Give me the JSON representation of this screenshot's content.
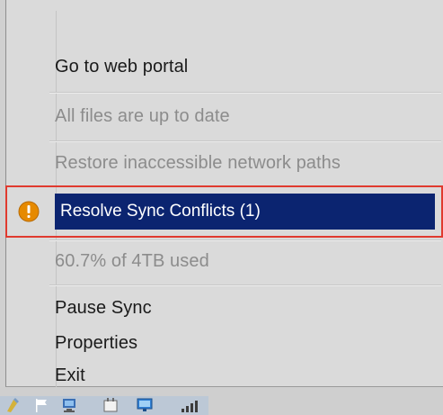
{
  "menu": {
    "items": [
      {
        "label": "Go to web portal",
        "enabled": true
      },
      {
        "label": "All files are up to date",
        "enabled": false
      },
      {
        "label": "Restore inaccessible network paths",
        "enabled": false
      },
      {
        "label": "Resolve Sync Conflicts (1)",
        "enabled": true,
        "highlighted": true,
        "icon": "warning-icon"
      },
      {
        "label": "60.7% of 4TB used",
        "enabled": false
      },
      {
        "label": "Pause Sync",
        "enabled": true
      },
      {
        "label": "Properties",
        "enabled": true
      },
      {
        "label": "Exit",
        "enabled": true
      }
    ]
  },
  "colors": {
    "highlight": "#0b2470",
    "annotation_border": "#e03a2f",
    "warning": "#e68a00"
  },
  "taskbar": {
    "tray_icons": [
      "sync-client-icon",
      "flag-icon",
      "network-icon",
      "device-icon",
      "monitor-icon",
      "signal-icon"
    ]
  }
}
